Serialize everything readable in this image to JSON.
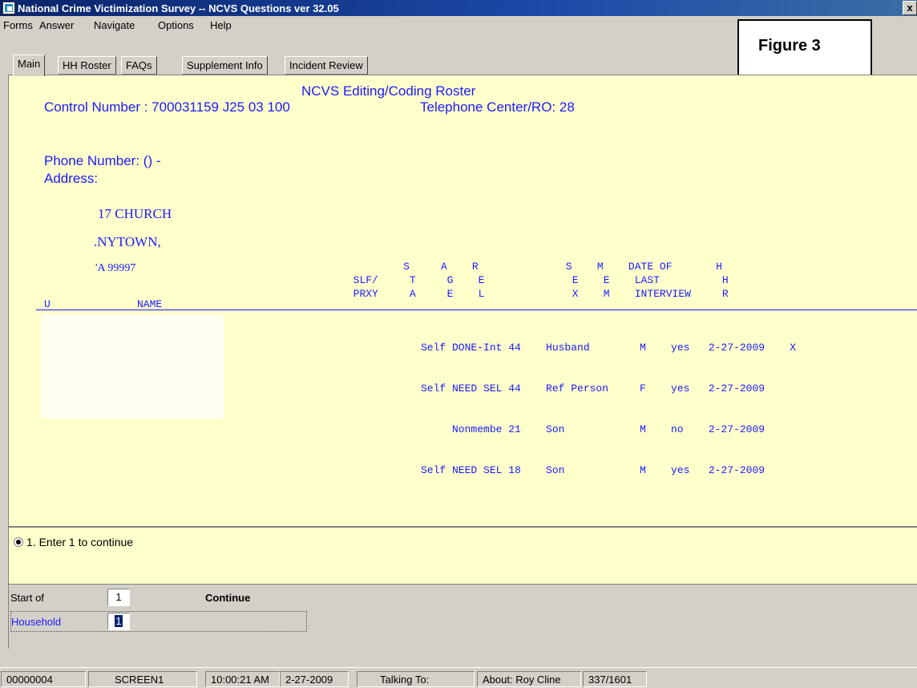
{
  "window": {
    "title": "National Crime Victimization Survey -- NCVS Questions ver 32.05",
    "close_glyph": "x"
  },
  "menu": [
    "Forms",
    "Answer",
    "Navigate",
    "Options",
    "Help"
  ],
  "figure_label": "Figure 3",
  "tabs": [
    "Main",
    "HH Roster",
    "FAQs",
    "Supplement Info",
    "Incident Review"
  ],
  "main": {
    "heading": "NCVS Editing/Coding Roster",
    "control_number": "Control Number : 700031159  J25 03 100",
    "telephone_center": "Telephone Center/RO: 28",
    "phone_number": "Phone Number: () -",
    "address_label": "Address:",
    "address_lines": [
      "17 CHURCH",
      ".NYTOWN,",
      "'A 99997"
    ]
  },
  "roster": {
    "header_rows": [
      "                                                  S     A    R              S    M    DATE OF       H",
      "                                          SLF/     T     G    E              E    E    LAST          H",
      "                                          PRXY     A     E    L              X    M    INTERVIEW     R"
    ],
    "name_header": "NAME",
    "left_fragment": "U",
    "rows": [
      "Self DONE-Int 44    Husband        M    yes   2-27-2009    X",
      "Self NEED SEL 44    Ref Person     F    yes   2-27-2009",
      "     Nonmembe 21    Son            M    no    2-27-2009",
      "Self NEED SEL 18    Son            M    yes   2-27-2009"
    ]
  },
  "prompt": {
    "option": "1.  Enter 1 to continue"
  },
  "entry": {
    "start_label": "Start of",
    "start_value": "1",
    "continue_label": "Continue",
    "household_label": "Household",
    "household_value": "1"
  },
  "status": {
    "case_id": "00000004",
    "screen": "SCREEN1",
    "time": "10:00:21 AM",
    "date": "2-27-2009",
    "talking_to": "Talking To:",
    "about": "About:  Roy Cline",
    "count": "337/1601"
  },
  "colors": {
    "panel_bg": "#ffffcc",
    "roster_text": "#1a1aff",
    "titlebar": "#0a246a"
  }
}
